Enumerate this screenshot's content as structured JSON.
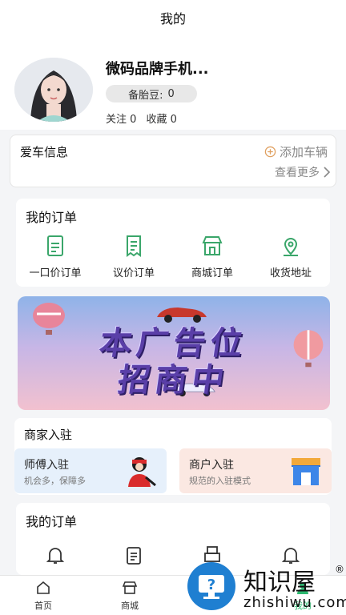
{
  "header": {
    "title": "我的"
  },
  "profile": {
    "username": "微码品牌手机...",
    "badge_label": "备胎豆:",
    "badge_value": "0",
    "follow_label": "关注",
    "follow_count": "0",
    "favorite_label": "收藏",
    "favorite_count": "0"
  },
  "car_info": {
    "title": "爱车信息",
    "add_label": "添加车辆",
    "more_label": "查看更多"
  },
  "orders": {
    "title": "我的订单",
    "items": [
      {
        "label": "一口价订单",
        "icon": "document-icon"
      },
      {
        "label": "议价订单",
        "icon": "receipt-icon"
      },
      {
        "label": "商城订单",
        "icon": "store-icon"
      },
      {
        "label": "收货地址",
        "icon": "location-icon"
      }
    ]
  },
  "banner": {
    "line1": "本广告位",
    "line2": "招商中"
  },
  "merchant": {
    "title": "商家入驻",
    "cards": [
      {
        "title": "师傅入驻",
        "subtitle": "机会多，保障多"
      },
      {
        "title": "商户入驻",
        "subtitle": "规范的入驻模式"
      }
    ]
  },
  "orders2": {
    "title": "我的订单"
  },
  "tabbar": {
    "items": [
      {
        "label": "首页"
      },
      {
        "label": "商城"
      },
      {
        "label": ""
      },
      {
        "label": "我的"
      }
    ]
  },
  "watermark": {
    "brand": "知识屋",
    "reg": "®",
    "url": "zhishiwu.com"
  },
  "colors": {
    "accent": "#2db870",
    "icon_green": "#3aa66a",
    "bg": "#f4f5f7"
  }
}
